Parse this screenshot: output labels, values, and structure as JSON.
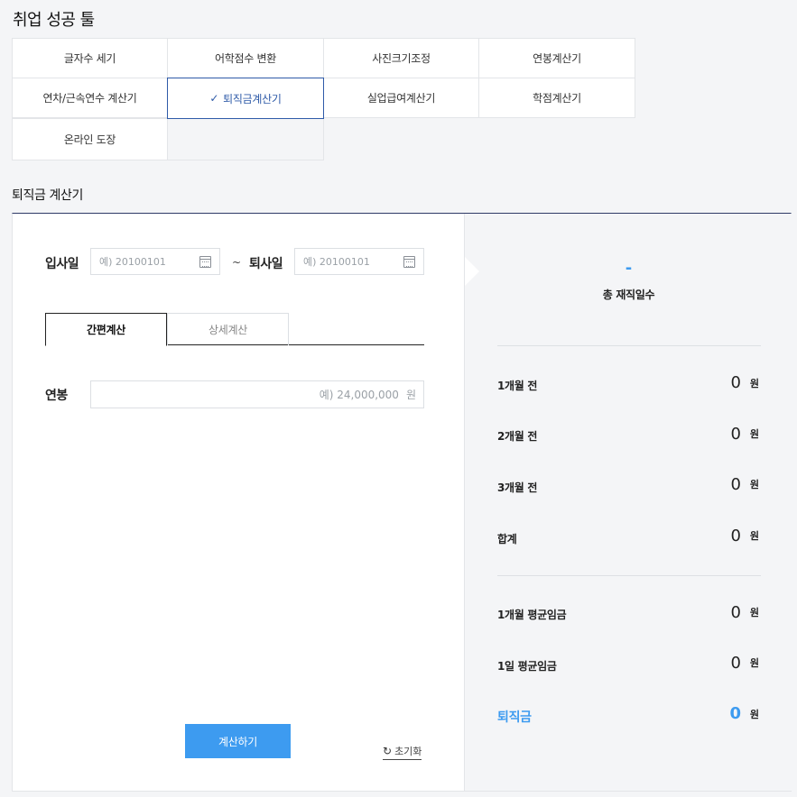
{
  "page": {
    "title": "취업 성공 툴"
  },
  "tools": [
    {
      "label": "글자수 세기"
    },
    {
      "label": "어학점수 변환"
    },
    {
      "label": "사진크기조정"
    },
    {
      "label": "연봉계산기"
    },
    {
      "label": "연차/근속연수 계산기"
    },
    {
      "label": "퇴직금계산기",
      "active": true
    },
    {
      "label": "실업급여계산기"
    },
    {
      "label": "학점계산기"
    },
    {
      "label": "온라인 도장"
    }
  ],
  "section": {
    "title": "퇴직금 계산기"
  },
  "form": {
    "start_label": "입사일",
    "start_placeholder": "예) 20100101",
    "tilde": "~",
    "end_label": "퇴사일",
    "end_placeholder": "예) 20100101",
    "tabs": [
      {
        "label": "간편계산",
        "active": true
      },
      {
        "label": "상세계산"
      }
    ],
    "salary_label": "연봉",
    "salary_placeholder": "예) 24,000,000",
    "salary_unit": "원",
    "calc_button": "계산하기",
    "reset_link": "초기화"
  },
  "result": {
    "total_days_value": "-",
    "total_days_label": "총 재직일수",
    "rows": [
      {
        "label": "1개월 전",
        "value": "0",
        "unit": "원"
      },
      {
        "label": "2개월 전",
        "value": "0",
        "unit": "원"
      },
      {
        "label": "3개월 전",
        "value": "0",
        "unit": "원"
      },
      {
        "label": "합계",
        "value": "0",
        "unit": "원"
      },
      {
        "label": "1개월 평균임금",
        "value": "0",
        "unit": "원"
      },
      {
        "label": "1일 평균임금",
        "value": "0",
        "unit": "원"
      },
      {
        "label": "퇴직금",
        "value": "0",
        "unit": "원"
      }
    ]
  },
  "colors": {
    "accent": "#3d9bf0",
    "active_border": "#2e5aa8",
    "panel_bg": "#f4f5f7"
  },
  "icons": {
    "active_tool": "check-icon",
    "date_picker": "calendar-icon",
    "reset": "refresh-icon"
  }
}
